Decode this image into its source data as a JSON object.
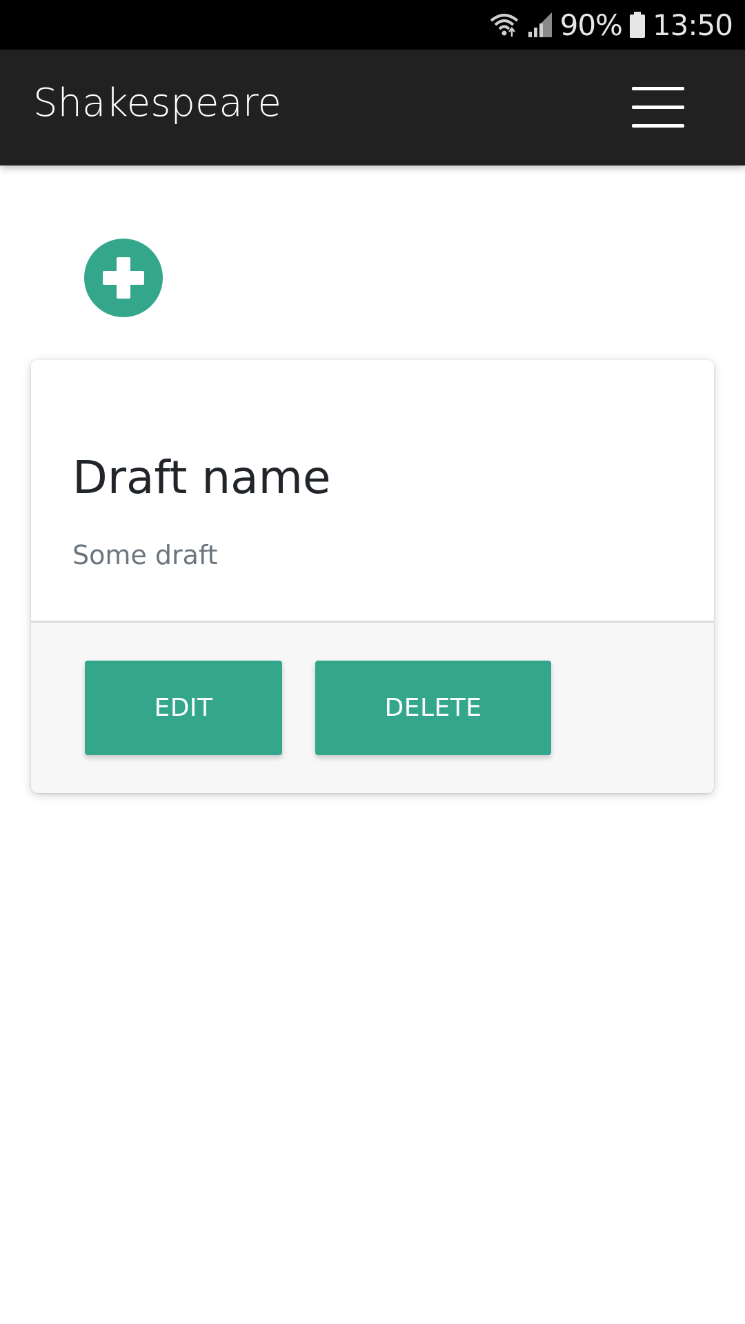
{
  "status_bar": {
    "battery": "90%",
    "time": "13:50",
    "icons": [
      "wifi-icon",
      "signal-icon",
      "battery-icon"
    ]
  },
  "app_bar": {
    "title": "Shakespeare",
    "menu_icon": "hamburger-menu-icon"
  },
  "add_button": {
    "icon": "plus-icon"
  },
  "draft_card": {
    "title": "Draft name",
    "text": "Some draft",
    "edit_label": "EDIT",
    "delete_label": "DELETE"
  },
  "colors": {
    "accent": "#33a68c",
    "app_bar": "#212121",
    "status_bar": "#000000",
    "card_footer": "#f7f7f7"
  }
}
